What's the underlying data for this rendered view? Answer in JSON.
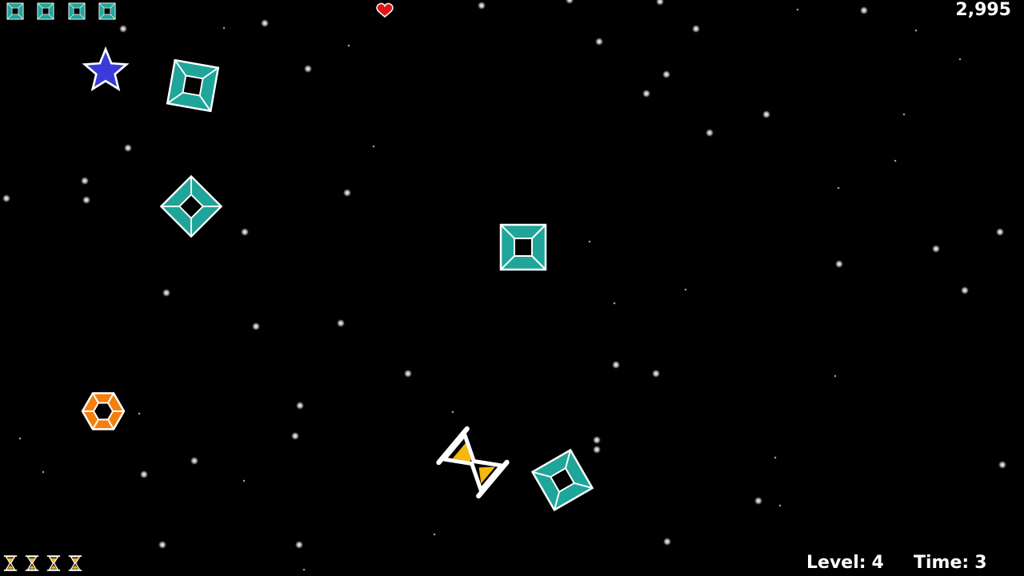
{
  "hud": {
    "score": "2,995",
    "level_label": "Level:",
    "level_value": "4",
    "time_label": "Time:",
    "time_value": "3",
    "lives": 1,
    "reserve_squares": 4,
    "reserve_hourglasses": 4
  },
  "colors": {
    "background": "#000000",
    "teal": "#1fa59a",
    "teal_outline": "#ffffff",
    "heart": "#e01414",
    "star": "#3b3bd9",
    "hexagon": "#f57f0c",
    "hourglass_sand": "#f5b80c",
    "text": "#ffffff"
  },
  "icons": {
    "life": "heart-icon",
    "reserve_square": "teal-square-icon",
    "reserve_hourglass": "hourglass-icon"
  },
  "entities": [
    "teal-square",
    "teal-square",
    "teal-square",
    "teal-square",
    "star",
    "hexagon",
    "hourglass"
  ]
}
